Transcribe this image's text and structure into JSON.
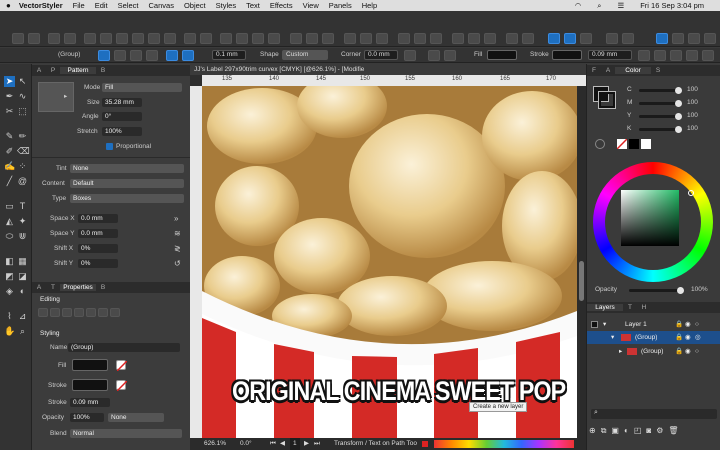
{
  "menubar": {
    "app": "VectorStyler",
    "items": [
      "File",
      "Edit",
      "Select",
      "Canvas",
      "Object",
      "Styles",
      "Text",
      "Effects",
      "View",
      "Panels",
      "Help"
    ],
    "clock": "Fri 16 Sep  3:04 pm"
  },
  "context_bar": {
    "selection": "(Group)",
    "stroke_width": "0.1 mm",
    "shape_label": "Shape",
    "shape_value": "Custom",
    "corner_label": "Corner",
    "corner_value": "0.0 mm",
    "fill_label": "Fill",
    "stroke_label": "Stroke",
    "stroke_value": "0.09 mm"
  },
  "pattern_panel": {
    "tabs": [
      "A",
      "P",
      "Pattern",
      "B"
    ],
    "mode_label": "Mode",
    "mode_value": "Fill",
    "size_label": "Size",
    "size_value": "35.28 mm",
    "angle_label": "Angle",
    "angle_value": "0°",
    "stretch_label": "Stretch",
    "stretch_value": "100%",
    "proportional": "Proportional",
    "tint_label": "Tint",
    "tint_value": "None",
    "content_label": "Content",
    "content_value": "Default",
    "type_label": "Type",
    "type_value": "Boxes",
    "space_x_label": "Space X",
    "space_x_value": "0.0 mm",
    "space_y_label": "Space Y",
    "space_y_value": "0.0 mm",
    "shift_x_label": "Shift X",
    "shift_x_value": "0%",
    "shift_y_label": "Shift Y",
    "shift_y_value": "0%"
  },
  "properties_panel": {
    "tabs": [
      "A",
      "T",
      "Properties",
      "B"
    ],
    "editing": "Editing",
    "styling": "Styling",
    "name_label": "Name",
    "name_value": "(Group)",
    "fill_label": "Fill",
    "stroke_label": "Stroke",
    "stroke_width_label": "Stroke",
    "stroke_width_value": "0.09 mm",
    "opacity_label": "Opacity",
    "opacity_value": "100%",
    "opacity_mode": "None",
    "blend_label": "Blend",
    "blend_value": "Normal"
  },
  "document": {
    "title": "JJ's Label 297x90trim curvex [CMYK] [@626.1%] - [Modified]",
    "tab_title": "JJ's Label 297x90trim curvex [CMYK] [@626.1%] - [Modifie",
    "ruler_ticks": [
      "135",
      "140",
      "145",
      "150",
      "155",
      "160",
      "165",
      "170"
    ],
    "banner_text": "ORIGINAL CINEMA SWEET POP",
    "tooltip": "Create a new layer",
    "zoom": "626.1%",
    "angle": "0.0°",
    "page": "1",
    "status_text": "Transform / Text on Path Too"
  },
  "color_panel": {
    "tabs": [
      "F",
      "A",
      "Color",
      "S"
    ],
    "channels": [
      {
        "name": "C",
        "value": "100",
        "level": 1.0
      },
      {
        "name": "M",
        "value": "100",
        "level": 1.0
      },
      {
        "name": "Y",
        "value": "100",
        "level": 1.0
      },
      {
        "name": "K",
        "value": "100",
        "level": 1.0
      }
    ],
    "opacity_label": "Opacity",
    "opacity_value": "100%"
  },
  "layers_panel": {
    "tabs": [
      "Layers",
      "T",
      "H"
    ],
    "layers": [
      {
        "name": "Layer 1",
        "level": 0,
        "selected": false
      },
      {
        "name": "(Group)",
        "level": 1,
        "selected": true
      },
      {
        "name": "(Group)",
        "level": 2,
        "selected": false
      }
    ]
  },
  "colors": {
    "accent": "#1e6fc0",
    "popcorn": "#e8c98a",
    "stripe_red": "#d42a26",
    "selection_blue": "#1d4f8c"
  }
}
